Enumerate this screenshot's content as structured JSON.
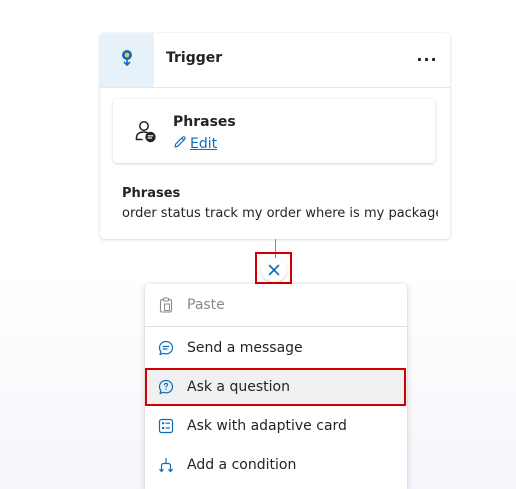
{
  "trigger": {
    "title": "Trigger",
    "more_label": "···",
    "icon": "trigger-icon",
    "accent_color": "#0f6cbd"
  },
  "phrases_box": {
    "title": "Phrases",
    "edit_label": "Edit",
    "icon": "phrases-person-icon"
  },
  "phrases": {
    "label": "Phrases",
    "value": "order status track my order where is my package"
  },
  "close_button": {
    "icon": "close-icon"
  },
  "menu": {
    "items": [
      {
        "label": "Paste",
        "icon": "paste-icon",
        "disabled": true
      },
      {
        "label": "Send a message",
        "icon": "message-icon"
      },
      {
        "label": "Ask a question",
        "icon": "question-icon",
        "selected": true
      },
      {
        "label": "Ask with adaptive card",
        "icon": "adaptive-card-icon"
      },
      {
        "label": "Add a condition",
        "icon": "condition-icon"
      }
    ]
  },
  "colors": {
    "accent": "#0f6cbd",
    "highlight_border": "#d20000"
  }
}
